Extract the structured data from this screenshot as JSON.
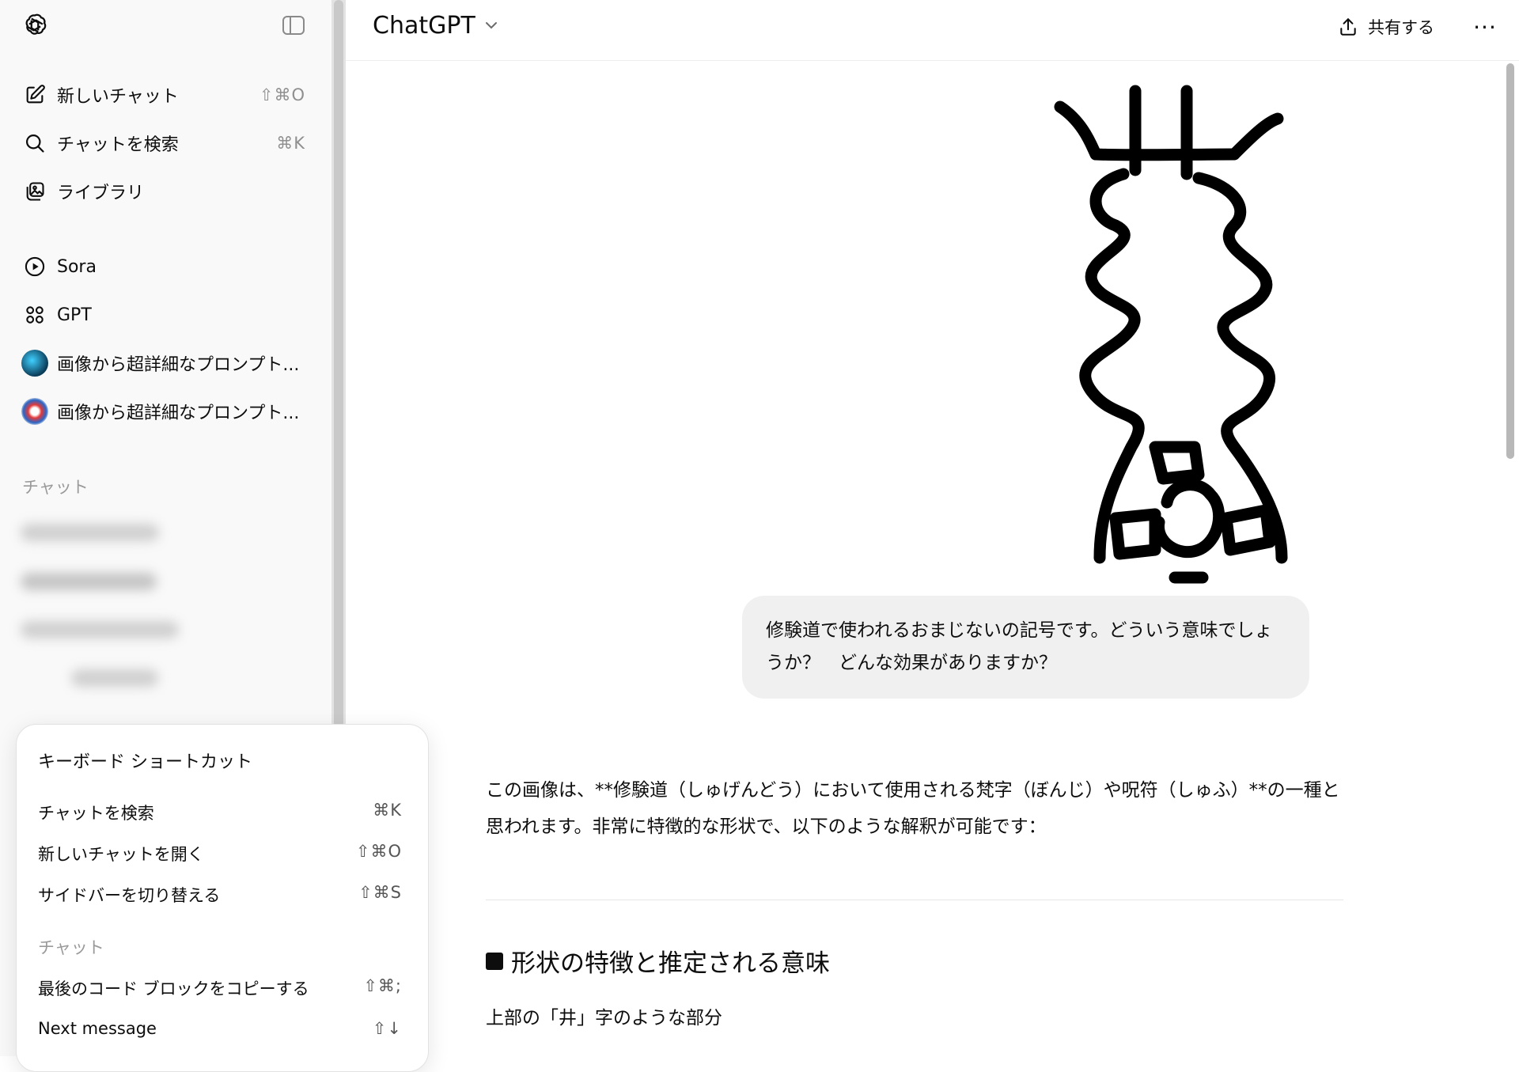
{
  "sidebar": {
    "items": [
      {
        "label": "新しいチャット",
        "shortcut": "⇧⌘O",
        "icon": "new-chat-icon"
      },
      {
        "label": "チャットを検索",
        "shortcut": "⌘K",
        "icon": "search-icon"
      },
      {
        "label": "ライブラリ",
        "icon": "library-icon"
      },
      {
        "label": "Sora",
        "icon": "sora-icon"
      },
      {
        "label": "GPT",
        "icon": "gpt-grid-icon"
      },
      {
        "label": "画像から超詳細なプロンプト...",
        "icon": "avatar-1"
      },
      {
        "label": "画像から超詳細なプロンプト...",
        "icon": "avatar-2"
      }
    ],
    "section_label": "チャット"
  },
  "header": {
    "model": "ChatGPT",
    "share_label": "共有する",
    "more_label": "···"
  },
  "conversation": {
    "user_message": "修験道で使われるおまじないの記号です。どういう意味でしょうか？　どんな効果がありますか？",
    "answer_paragraph": "この画像は、**修験道（しゅげんどう）において使用される梵字（ぼんじ）や呪符（しゅふ）**の一種と思われます。非常に特徴的な形状で、以下のような解釈が可能です：",
    "section_heading": "形状の特徴と推定される意味",
    "subheading": "上部の「井」字のような部分"
  },
  "shortcuts_popover": {
    "title": "キーボード ショートカット",
    "rows": [
      {
        "label": "チャットを検索",
        "keys": "⌘K"
      },
      {
        "label": "新しいチャットを開く",
        "keys": "⇧⌘O"
      },
      {
        "label": "サイドバーを切り替える",
        "keys": "⇧⌘S"
      }
    ],
    "section": "チャット",
    "chat_rows": [
      {
        "label": "最後のコード ブロックをコピーする",
        "keys": "⇧⌘;"
      },
      {
        "label": "Next message",
        "keys": "⇧↓"
      }
    ]
  },
  "colors": {
    "sidebar_bg": "#f9f9f9",
    "bubble_bg": "#f0f0f0",
    "text": "#0d0d0d",
    "muted": "#8f8f8f"
  }
}
